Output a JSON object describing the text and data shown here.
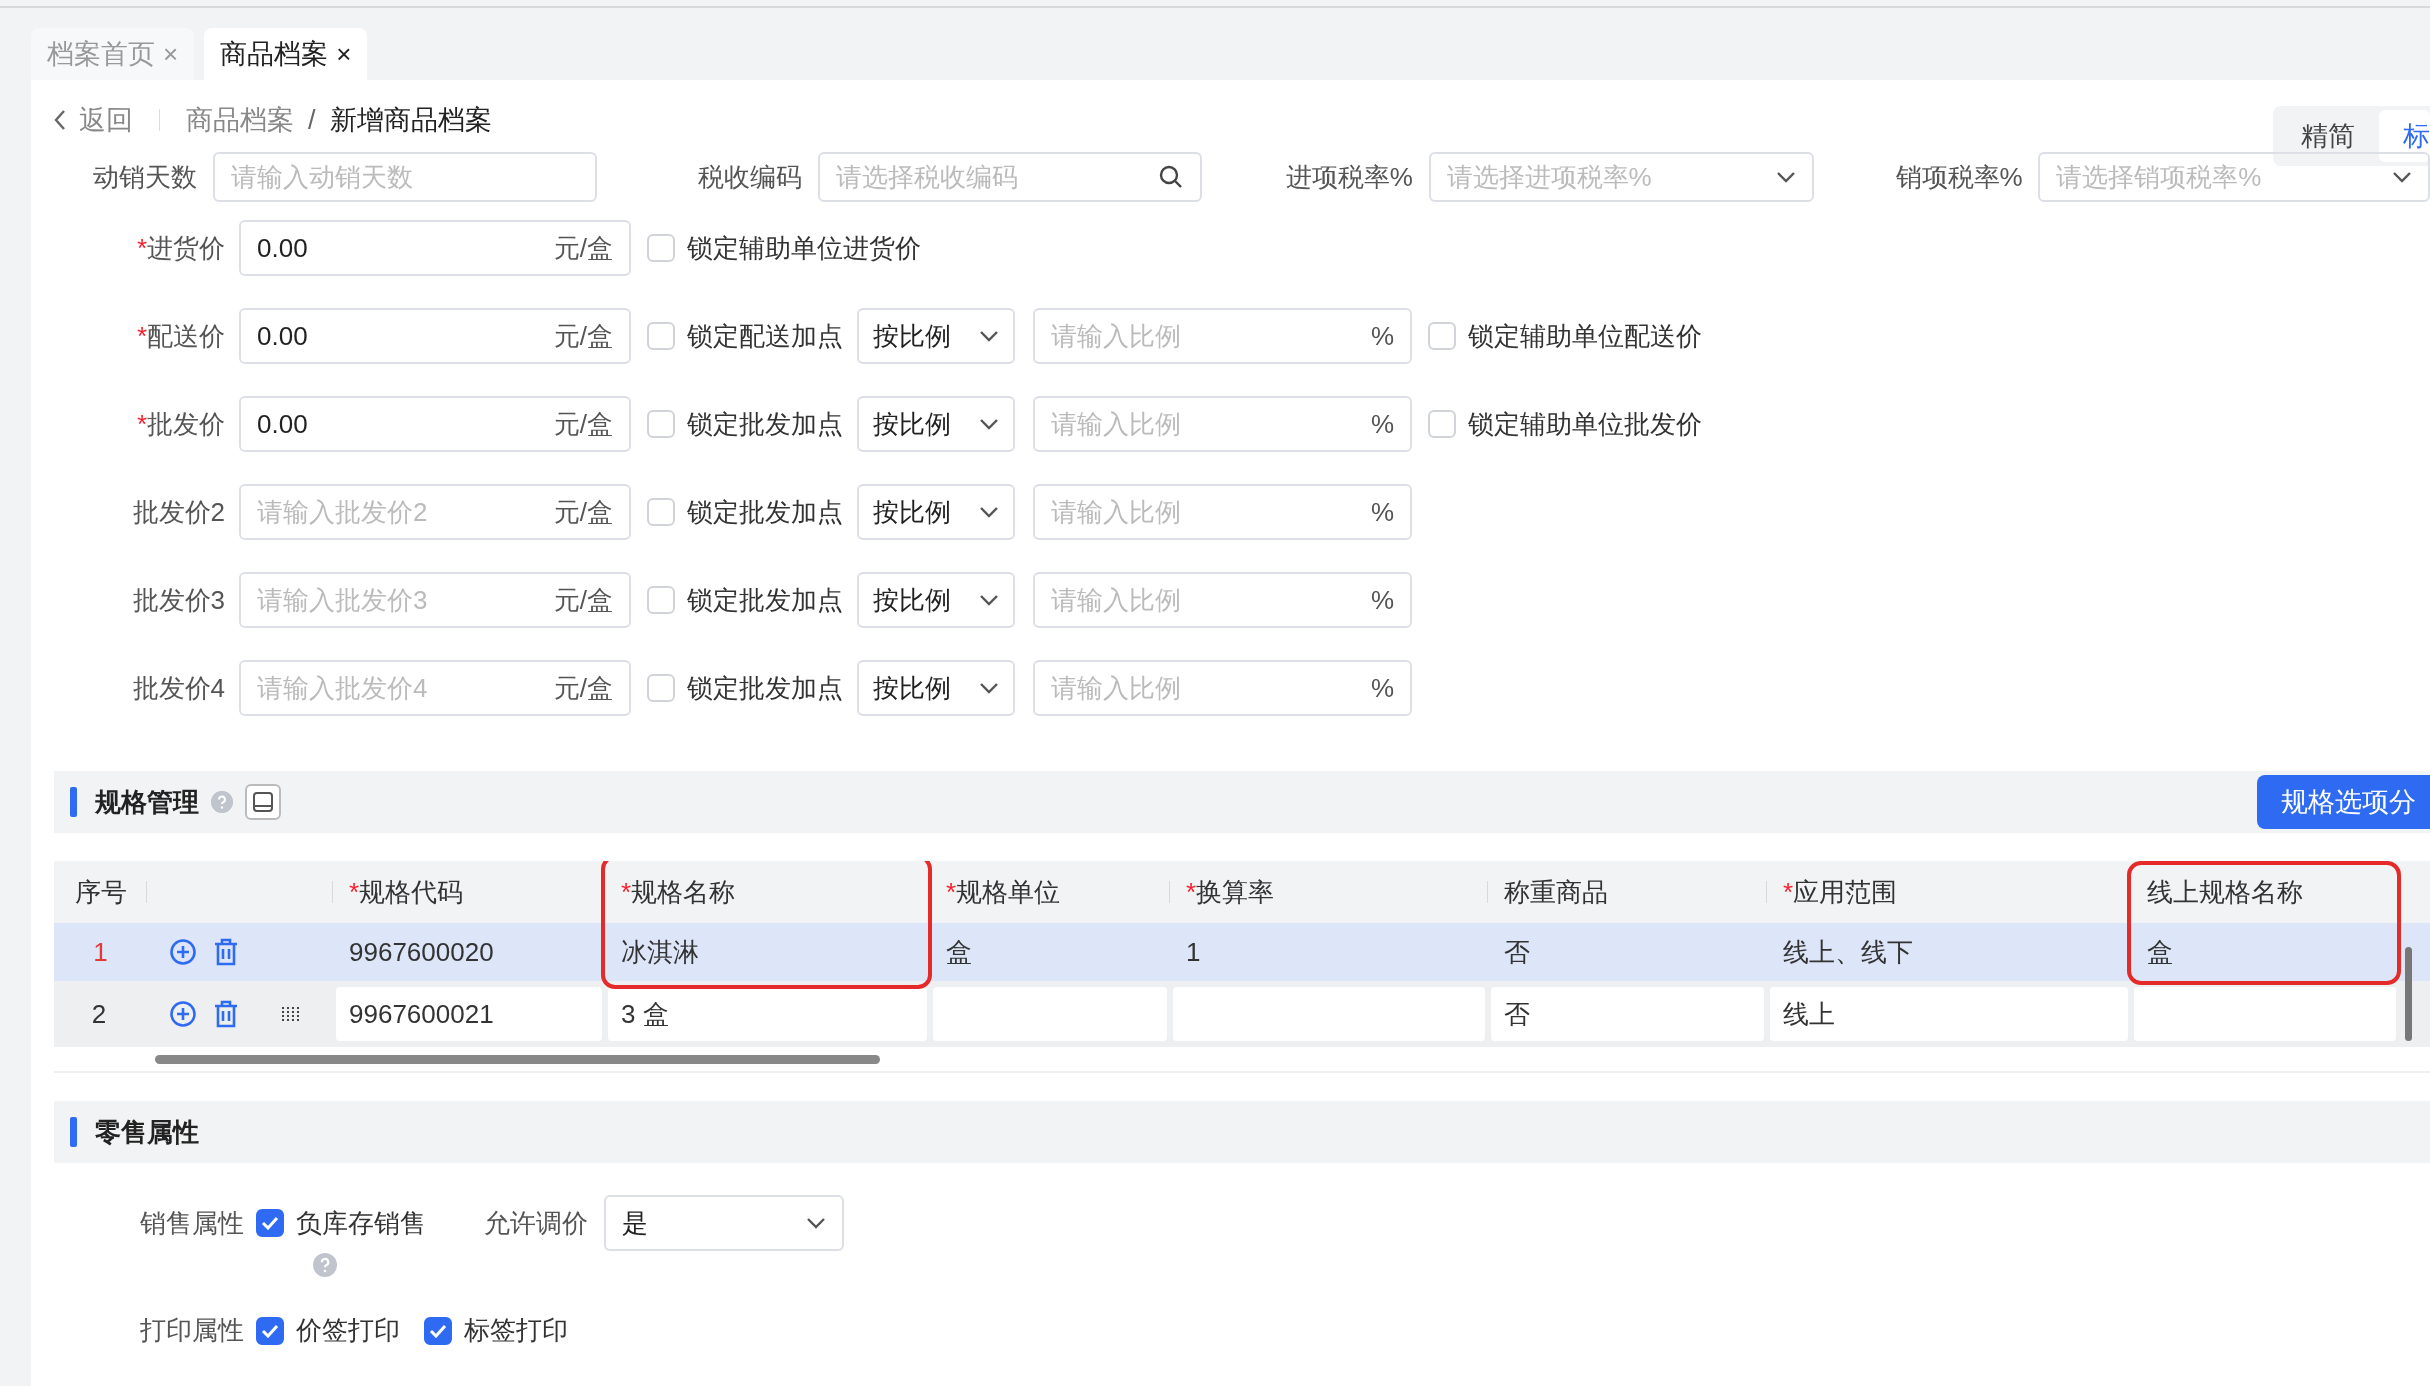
{
  "tabs": [
    {
      "label": "档案首页",
      "close": "×",
      "selected": false
    },
    {
      "label": "商品档案",
      "close": "×",
      "selected": true
    }
  ],
  "breadcrumb": {
    "back": "返回",
    "items": [
      "商品档案",
      "新增商品档案"
    ],
    "separator": "/"
  },
  "view_toggle": [
    {
      "label": "精简",
      "selected": false
    },
    {
      "label": "标",
      "selected": true
    }
  ],
  "top_fields": [
    {
      "label": "动销天数",
      "placeholder": "请输入动销天数",
      "kind": "text"
    },
    {
      "label": "税收编码",
      "placeholder": "请选择税收编码",
      "kind": "search"
    },
    {
      "label": "进项税率%",
      "placeholder": "请选择进项税率%",
      "kind": "select"
    },
    {
      "label": "销项税率%",
      "placeholder": "请选择销项税率%",
      "kind": "select"
    }
  ],
  "price_rows": [
    {
      "mark": "*",
      "label": "进货价",
      "value": "0.00",
      "unit": "元/盒",
      "lock": {
        "label": "锁定辅助单位进货价",
        "checked": false
      }
    },
    {
      "mark": "*",
      "label": "配送价",
      "value": "0.00",
      "unit": "元/盒",
      "lock": {
        "label": "锁定配送加点",
        "checked": false
      },
      "mode": "按比例",
      "ratio": {
        "placeholder": "请输入比例",
        "unit": "%"
      },
      "aux_lock": {
        "label": "锁定辅助单位配送价",
        "checked": false
      }
    },
    {
      "mark": "*",
      "label": "批发价",
      "value": "0.00",
      "unit": "元/盒",
      "lock": {
        "label": "锁定批发加点",
        "checked": false
      },
      "mode": "按比例",
      "ratio": {
        "placeholder": "请输入比例",
        "unit": "%"
      },
      "aux_lock": {
        "label": "锁定辅助单位批发价",
        "checked": false
      }
    },
    {
      "label": "批发价2",
      "placeholder": "请输入批发价2",
      "unit": "元/盒",
      "lock": {
        "label": "锁定批发加点",
        "checked": false
      },
      "mode": "按比例",
      "ratio": {
        "placeholder": "请输入比例",
        "unit": "%"
      }
    },
    {
      "label": "批发价3",
      "placeholder": "请输入批发价3",
      "unit": "元/盒",
      "lock": {
        "label": "锁定批发加点",
        "checked": false
      },
      "mode": "按比例",
      "ratio": {
        "placeholder": "请输入比例",
        "unit": "%"
      }
    },
    {
      "label": "批发价4",
      "placeholder": "请输入批发价4",
      "unit": "元/盒",
      "lock": {
        "label": "锁定批发加点",
        "checked": false
      },
      "mode": "按比例",
      "ratio": {
        "placeholder": "请输入比例",
        "unit": "%"
      }
    }
  ],
  "spec_section": {
    "title": "规格管理",
    "action": "规格选项分"
  },
  "table": {
    "index_header": "序号",
    "columns": [
      {
        "mark": "*",
        "label": "规格代码",
        "highlighted": false
      },
      {
        "mark": "*",
        "label": "规格名称",
        "highlighted": true
      },
      {
        "mark": "*",
        "label": "规格单位",
        "highlighted": false
      },
      {
        "mark": "*",
        "label": "换算率",
        "highlighted": false
      },
      {
        "label": "称重商品",
        "highlighted": false
      },
      {
        "mark": "*",
        "label": "应用范围",
        "highlighted": false
      },
      {
        "label": "线上规格名称",
        "highlighted": true
      }
    ],
    "rows": [
      {
        "index": "1",
        "selected": true,
        "editable": false,
        "cells": [
          {
            "value": "9967600020"
          },
          {
            "value": "冰淇淋"
          },
          {
            "value": "盒"
          },
          {
            "value": "1"
          },
          {
            "value": "否"
          },
          {
            "value": "线上、线下"
          },
          {
            "value": "盒"
          }
        ]
      },
      {
        "index": "2",
        "selected": false,
        "editable": true,
        "cells": [
          {
            "value": "9967600021"
          },
          {
            "value": "3 盒"
          },
          {},
          {},
          {
            "value": "否"
          },
          {
            "value": "线上"
          },
          {}
        ]
      }
    ]
  },
  "retail_section": {
    "title": "零售属性",
    "sales": {
      "label": "销售属性",
      "option": {
        "label": "负库存销售",
        "checked": true
      },
      "price_adjust": {
        "label": "允许调价",
        "value": "是"
      }
    },
    "print": {
      "label": "打印属性",
      "options": [
        {
          "label": "价签打印",
          "checked": true
        },
        {
          "label": "标签打印",
          "checked": true
        }
      ]
    }
  }
}
